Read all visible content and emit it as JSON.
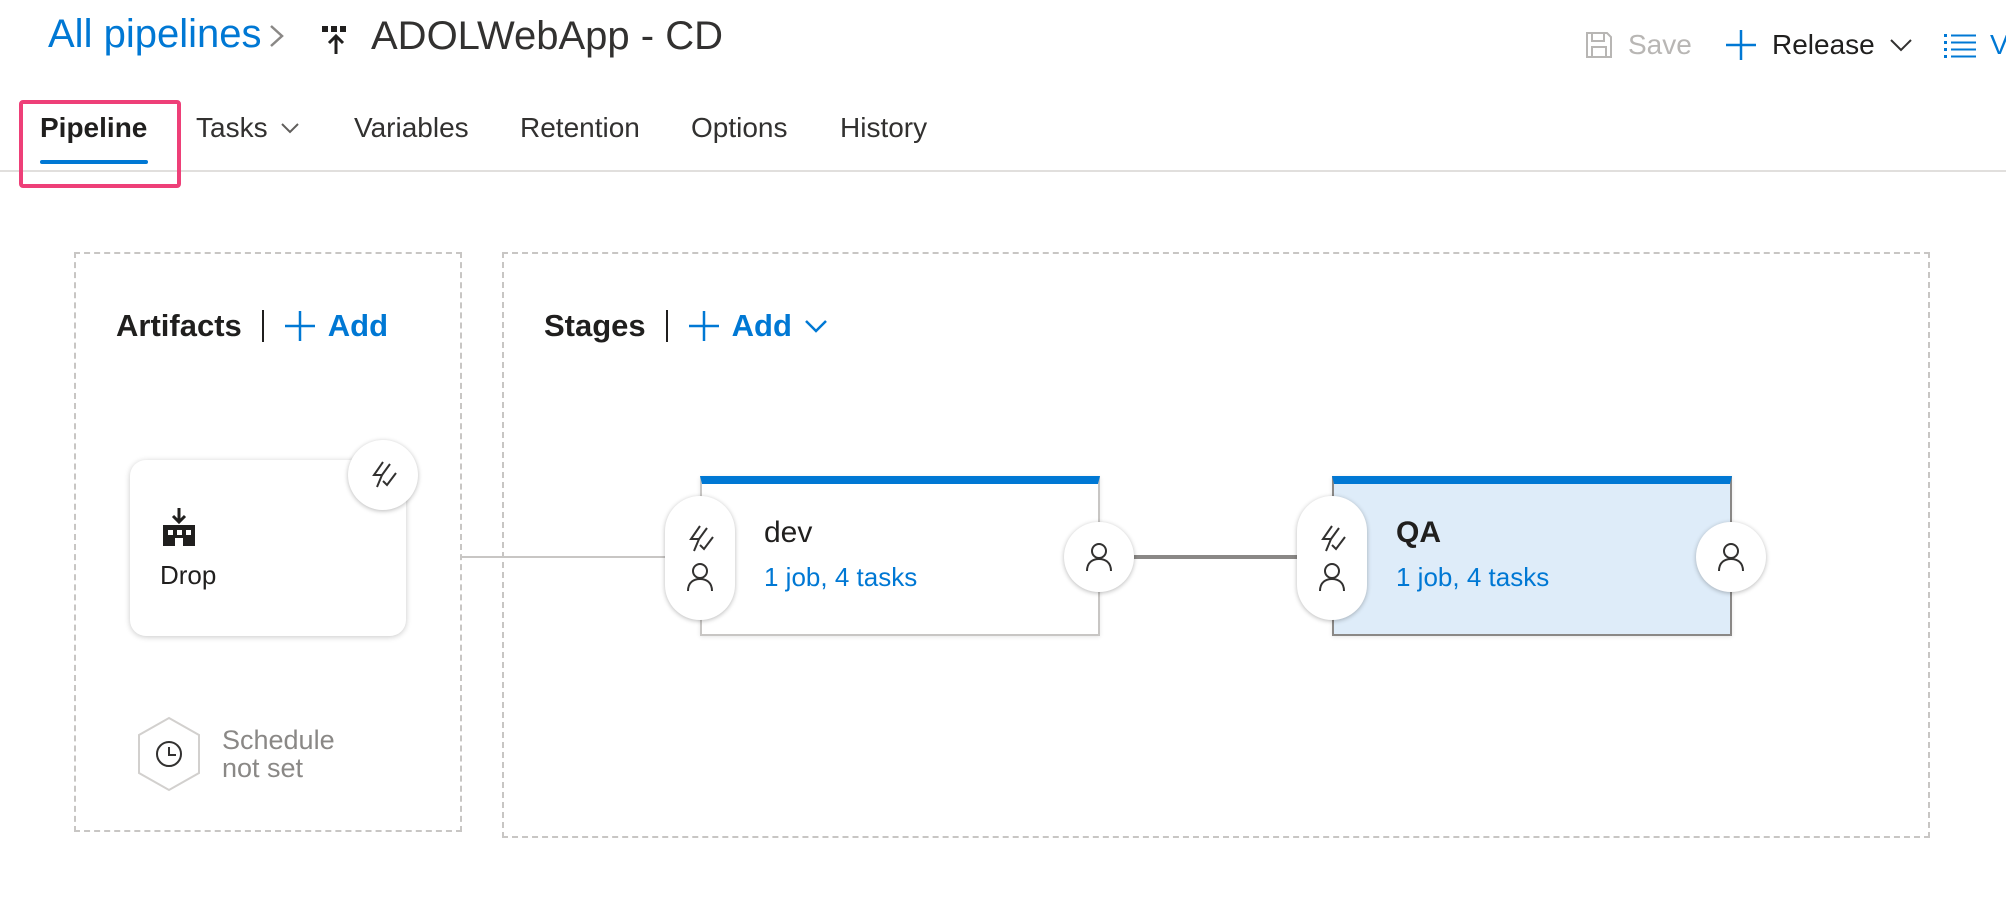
{
  "header": {
    "breadcrumb_root": "All pipelines",
    "pipeline_name": "ADOLWebApp - CD",
    "save_label": "Save",
    "release_label": "Release",
    "view_label": "V"
  },
  "tabs": [
    {
      "label": "Pipeline",
      "active": true
    },
    {
      "label": "Tasks",
      "has_dropdown": true
    },
    {
      "label": "Variables"
    },
    {
      "label": "Retention"
    },
    {
      "label": "Options"
    },
    {
      "label": "History"
    }
  ],
  "artifacts": {
    "title": "Artifacts",
    "add_label": "Add",
    "items": [
      {
        "name": "Drop",
        "icon": "build-artifact-icon"
      }
    ],
    "schedule_line1": "Schedule",
    "schedule_line2": "not set"
  },
  "stages": {
    "title": "Stages",
    "add_label": "Add",
    "items": [
      {
        "name": "dev",
        "summary": "1 job, 4 tasks",
        "selected": false
      },
      {
        "name": "QA",
        "summary": "1 job, 4 tasks",
        "selected": true
      }
    ]
  },
  "colors": {
    "accent": "#0078d4",
    "highlight_box": "#ee3f78",
    "selected_stage_bg": "#deecf9",
    "muted_text": "#8a8886"
  }
}
